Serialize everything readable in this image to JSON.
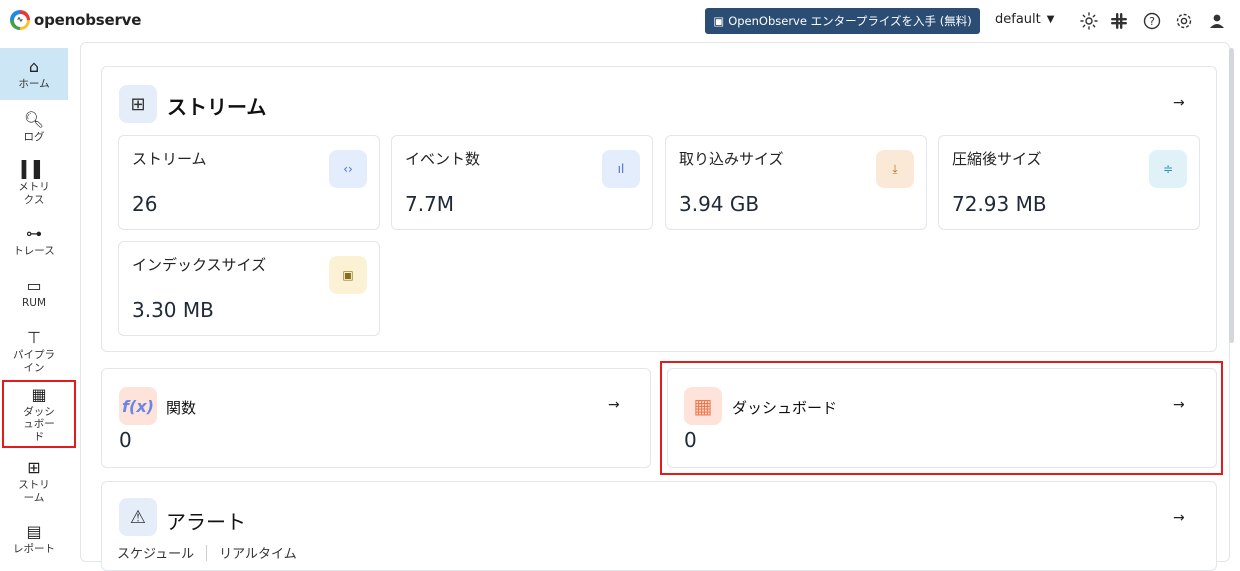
{
  "header": {
    "logo_text": "openobserve",
    "enterprise_button": "OpenObserve エンタープライズを入手 (無料)",
    "org": "default"
  },
  "sidebar": {
    "items": [
      {
        "label": "ホーム",
        "icon": "home-icon"
      },
      {
        "label": "ログ",
        "icon": "search-icon"
      },
      {
        "label": "メトリクス",
        "icon": "bar-chart-icon"
      },
      {
        "label": "トレース",
        "icon": "trace-icon"
      },
      {
        "label": "RUM",
        "icon": "devices-icon"
      },
      {
        "label": "パイプライン",
        "icon": "pipeline-icon"
      },
      {
        "label": "ダッシュボード",
        "icon": "dashboard-icon"
      },
      {
        "label": "ストリーム",
        "icon": "grid-icon"
      },
      {
        "label": "レポート",
        "icon": "report-icon"
      }
    ]
  },
  "streams": {
    "title": "ストリーム",
    "cards": [
      {
        "label": "ストリーム",
        "value": "26",
        "icon": "code-icon",
        "color": "#e3edfb"
      },
      {
        "label": "イベント数",
        "value": "7.7M",
        "icon": "bar-chart-icon",
        "color": "#e3edfb"
      },
      {
        "label": "取り込みサイズ",
        "value": "3.94 GB",
        "icon": "download-icon",
        "color": "#fbe9d7"
      },
      {
        "label": "圧縮後サイズ",
        "value": "72.93 MB",
        "icon": "compress-icon",
        "color": "#e0f1f7"
      },
      {
        "label": "インデックスサイズ",
        "value": "3.30 MB",
        "icon": "save-icon",
        "color": "#fbf2d6"
      }
    ]
  },
  "functions": {
    "title": "関数",
    "value": "0"
  },
  "dashboards": {
    "title": "ダッシュボード",
    "value": "0"
  },
  "alerts": {
    "title": "アラート",
    "tabs": [
      "スケジュール",
      "リアルタイム"
    ]
  }
}
